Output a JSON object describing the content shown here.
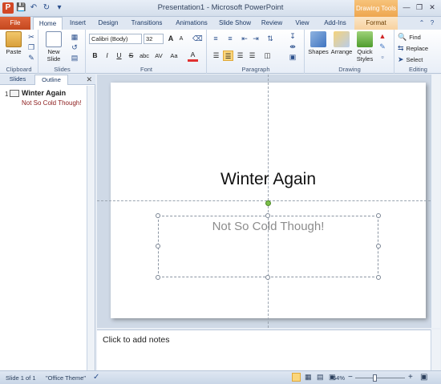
{
  "window": {
    "title": "Presentation1  -  Microsoft PowerPoint",
    "contextual_header": "Drawing Tools"
  },
  "tabs": [
    "File",
    "Home",
    "Insert",
    "Design",
    "Transitions",
    "Animations",
    "Slide Show",
    "Review",
    "View",
    "Add-Ins",
    "Format"
  ],
  "active_tab": "Home",
  "ribbon": {
    "clipboard": {
      "label": "Clipboard",
      "paste": "Paste"
    },
    "slides": {
      "label": "Slides",
      "new_slide": "New Slide"
    },
    "font": {
      "label": "Font",
      "font_name": "Calibri (Body)",
      "font_size": "32",
      "bold": "B",
      "italic": "I",
      "underline": "U",
      "strike": "S",
      "shadow": "abc",
      "spacing": "AV",
      "case": "Aa",
      "color": "A",
      "grow": "A",
      "shrink": "A"
    },
    "paragraph": {
      "label": "Paragraph"
    },
    "drawing": {
      "label": "Drawing",
      "shapes": "Shapes",
      "arrange": "Arrange",
      "quick_styles": "Quick Styles"
    },
    "editing": {
      "label": "Editing",
      "find": "Find",
      "replace": "Replace",
      "select": "Select"
    }
  },
  "left_panel": {
    "tabs": [
      "Slides",
      "Outline"
    ],
    "active_tab": "Outline",
    "slide_number": "1",
    "slide_title": "Winter Again",
    "slide_subtitle": "Not So Cold Though!"
  },
  "slide": {
    "title": "Winter Again",
    "subtitle": "Not So Cold Though!"
  },
  "notes": {
    "placeholder": "Click to add notes"
  },
  "status": {
    "slide_info": "Slide 1 of 1",
    "theme": "\"Office Theme\"",
    "zoom": "64%",
    "zoom_level": 0.64
  }
}
